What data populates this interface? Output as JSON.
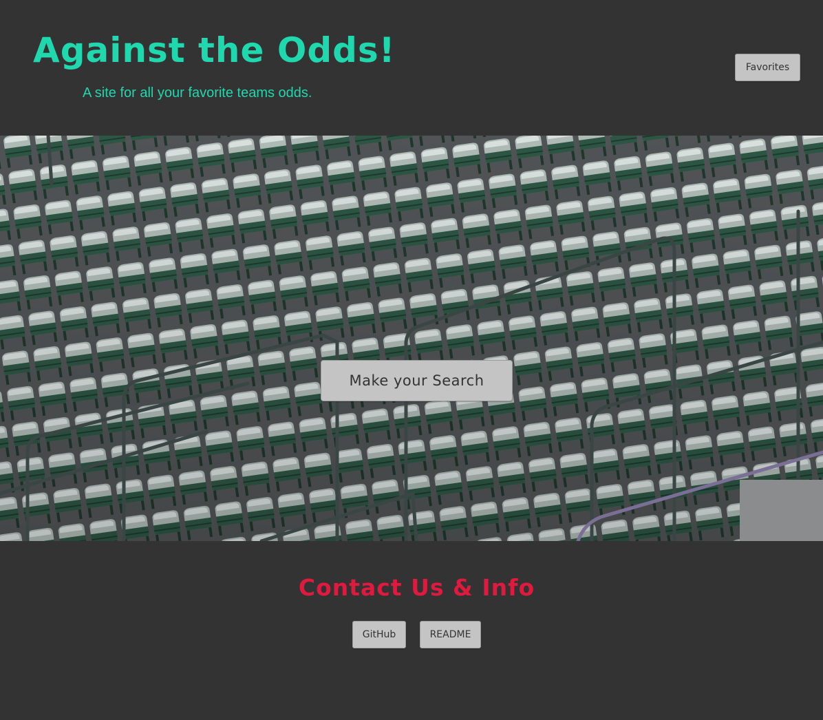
{
  "header": {
    "title": "Against the Odds!",
    "tagline": "A site for all your favorite teams odds.",
    "favorites_label": "Favorites"
  },
  "hero": {
    "image": "stadium-seats-photo",
    "search_label": "Make your Search"
  },
  "footer": {
    "title": "Contact Us & Info",
    "github_label": "GitHub",
    "readme_label": "README"
  },
  "colors": {
    "background": "#333333",
    "title_accent": "#1fd8ae",
    "contact_accent": "#e0193f",
    "button_bg": "#c4c4c4"
  }
}
